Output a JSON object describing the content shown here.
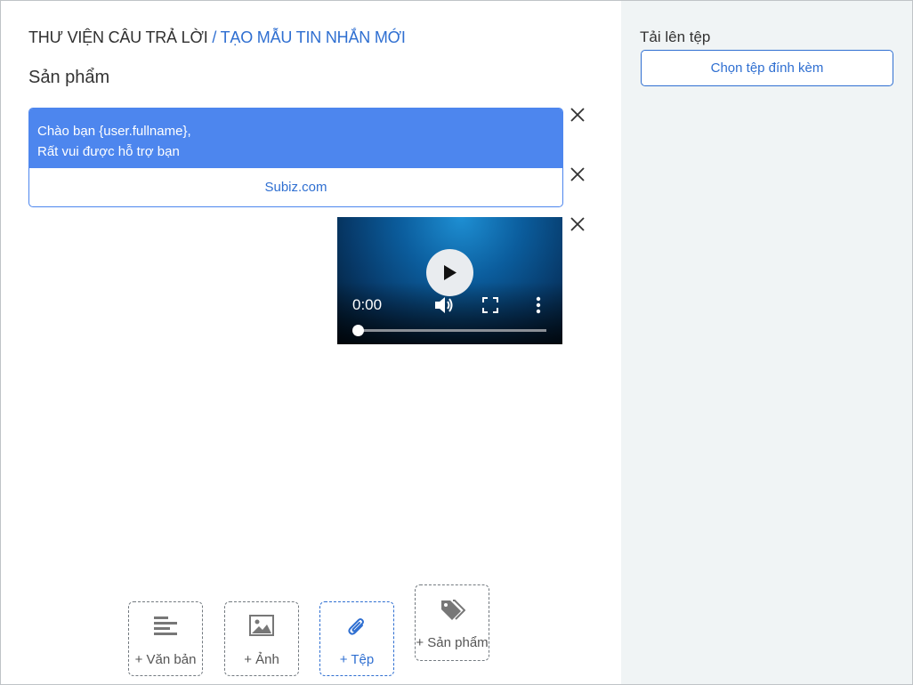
{
  "breadcrumb": {
    "root": "THƯ VIỆN CÂU TRẢ LỜI",
    "separator": " / ",
    "current": "TẠO MẪU TIN NHẮN MỚI"
  },
  "page_title": "Sản phẩm",
  "text_block": {
    "line1": "Chào bạn {user.fullname},",
    "line2": "Rất vui được hỗ trợ bạn",
    "button_label": "Subiz.com"
  },
  "video": {
    "time": "0:00",
    "progress": 0
  },
  "add_buttons": {
    "text": "+ Văn bản",
    "image": "+ Ảnh",
    "file": "+ Tệp",
    "product": "+ Sản phẩm"
  },
  "sidebar": {
    "upload_label": "Tải lên tệp",
    "upload_button": "Chọn tệp đính kèm"
  },
  "colors": {
    "accent": "#2f6fd1",
    "message_bg": "#4d86ee",
    "sidebar_bg": "#f0f4f5"
  },
  "icons": [
    "close-icon",
    "play-icon",
    "volume-icon",
    "fullscreen-icon",
    "more-vert-icon",
    "align-left-icon",
    "image-icon",
    "paperclip-icon",
    "tag-icon"
  ]
}
